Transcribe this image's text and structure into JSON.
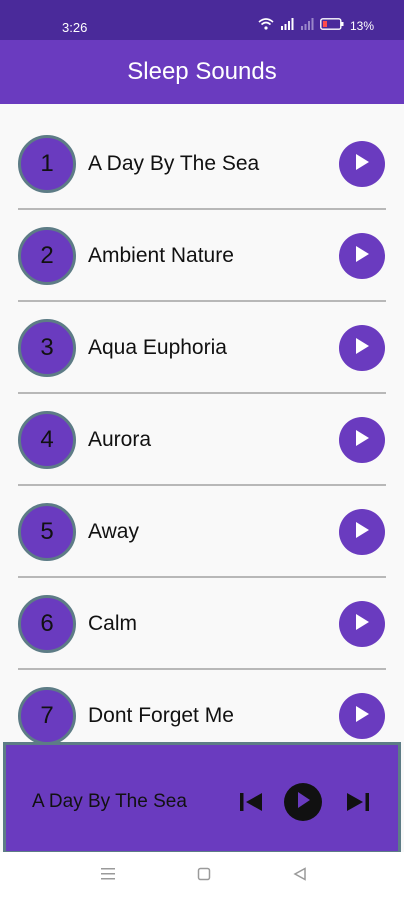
{
  "status_bar": {
    "time": "3:26",
    "battery_percent": "13%",
    "icons": [
      "wifi-icon",
      "signal-icon",
      "signal-icon",
      "battery-icon"
    ]
  },
  "app_bar": {
    "title": "Sleep Sounds"
  },
  "sounds": [
    {
      "number": "1",
      "name": "A Day By The Sea"
    },
    {
      "number": "2",
      "name": "Ambient Nature"
    },
    {
      "number": "3",
      "name": "Aqua Euphoria"
    },
    {
      "number": "4",
      "name": "Aurora"
    },
    {
      "number": "5",
      "name": "Away"
    },
    {
      "number": "6",
      "name": "Calm"
    },
    {
      "number": "7",
      "name": "Dont Forget Me"
    }
  ],
  "player": {
    "now_playing": "A Day By The Sea",
    "controls": [
      "skip-previous-icon",
      "play-icon",
      "skip-next-icon"
    ]
  },
  "nav_bar": {
    "buttons": [
      "menu-icon",
      "home-icon",
      "back-icon"
    ]
  },
  "colors": {
    "accent": "#6a3bbf",
    "status_bar": "#4a2a9a",
    "ring": "#5d7c86"
  }
}
